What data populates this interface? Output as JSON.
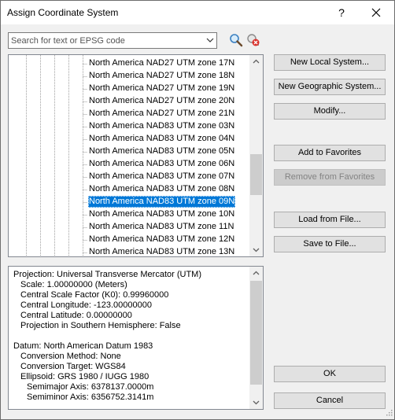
{
  "window": {
    "title": "Assign Coordinate System",
    "help_label": "?"
  },
  "search": {
    "placeholder": "Search for text or EPSG code",
    "value": ""
  },
  "tree": {
    "selected_index": 11,
    "items": [
      {
        "label": "North America NAD27 UTM zone 17N"
      },
      {
        "label": "North America NAD27 UTM zone 18N"
      },
      {
        "label": "North America NAD27 UTM zone 19N"
      },
      {
        "label": "North America NAD27 UTM zone 20N"
      },
      {
        "label": "North America NAD27 UTM zone 21N"
      },
      {
        "label": "North America NAD83 UTM zone 03N"
      },
      {
        "label": "North America NAD83 UTM zone 04N"
      },
      {
        "label": "North America NAD83 UTM zone 05N"
      },
      {
        "label": "North America NAD83 UTM zone 06N"
      },
      {
        "label": "North America NAD83 UTM zone 07N"
      },
      {
        "label": "North America NAD83 UTM zone 08N"
      },
      {
        "label": "North America NAD83 UTM zone 09N"
      },
      {
        "label": "North America NAD83 UTM zone 10N"
      },
      {
        "label": "North America NAD83 UTM zone 11N"
      },
      {
        "label": "North America NAD83 UTM zone 12N"
      },
      {
        "label": "North America NAD83 UTM zone 13N"
      }
    ]
  },
  "details": {
    "lines": [
      {
        "text": "Projection: Universal Transverse Mercator (UTM)",
        "indent": 0
      },
      {
        "text": "Scale: 1.00000000 (Meters)",
        "indent": 1
      },
      {
        "text": "Central Scale Factor (K0): 0.99960000",
        "indent": 1
      },
      {
        "text": "Central Longitude: -123.00000000",
        "indent": 1
      },
      {
        "text": "Central Latitude: 0.00000000",
        "indent": 1
      },
      {
        "text": "Projection in Southern Hemisphere: False",
        "indent": 1
      },
      {
        "text": "",
        "indent": 0
      },
      {
        "text": "Datum: North American Datum 1983",
        "indent": 0
      },
      {
        "text": "Conversion Method: None",
        "indent": 1
      },
      {
        "text": "Conversion Target: WGS84",
        "indent": 1
      },
      {
        "text": "Ellipsoid: GRS 1980 / IUGG 1980",
        "indent": 1
      },
      {
        "text": "Semimajor Axis: 6378137.0000m",
        "indent": 2
      },
      {
        "text": "Semiminor Axis: 6356752.3141m",
        "indent": 2
      }
    ]
  },
  "buttons": {
    "new_local": "New Local System...",
    "new_geographic": "New Geographic System...",
    "modify": "Modify...",
    "add_favorites": "Add to Favorites",
    "remove_favorites": "Remove from Favorites",
    "load_file": "Load from File...",
    "save_file": "Save to File...",
    "ok": "OK",
    "cancel": "Cancel"
  },
  "colors": {
    "selection": "#0078d7",
    "dialog_bg": "#f0f0f0",
    "button_bg": "#e1e1e1"
  },
  "icons": {
    "search": "magnifier-icon",
    "clear": "clear-search-icon",
    "close": "close-icon",
    "dropdown": "chevron-down-icon"
  }
}
